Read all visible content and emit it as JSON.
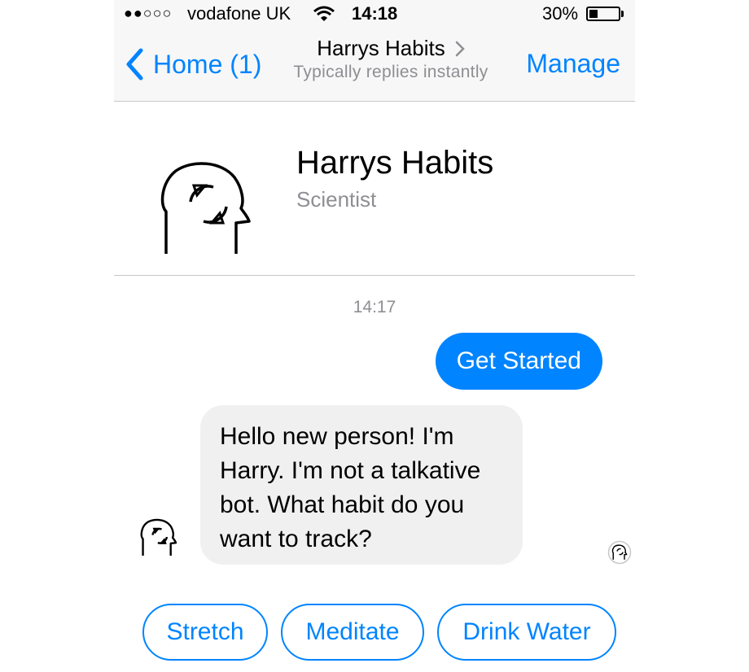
{
  "status_bar": {
    "signal": "●●○○○",
    "carrier": "vodafone UK",
    "wifi_icon": "wifi-icon",
    "time": "14:18",
    "battery_percent": "30%",
    "battery_level": 0.3
  },
  "nav": {
    "back_label": "Home (1)",
    "title": "Harrys Habits",
    "subtitle": "Typically replies instantly",
    "manage_label": "Manage"
  },
  "profile": {
    "name": "Harrys Habits",
    "role": "Scientist",
    "logo_icon": "head-cycle-icon"
  },
  "conversation": {
    "timestamp": "14:17",
    "outgoing": "Get Started",
    "incoming": "Hello new person! I'm Harry. I'm not a talkative bot. What habit do you want to track?"
  },
  "quick_replies": [
    {
      "label": "Stretch"
    },
    {
      "label": "Meditate"
    },
    {
      "label": "Drink Water"
    }
  ],
  "colors": {
    "accent": "#0084ff",
    "incoming_bubble": "#f1f0f0",
    "secondary_text": "#8e8e93"
  }
}
